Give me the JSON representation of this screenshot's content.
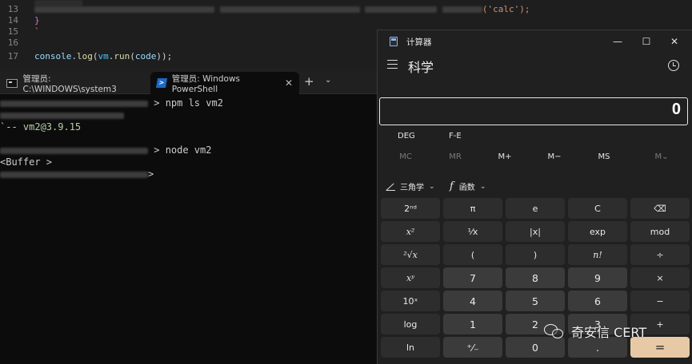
{
  "editor": {
    "lines": [
      {
        "num": "13",
        "code_tail": "('calc');"
      },
      {
        "num": "14",
        "code": "}"
      },
      {
        "num": "15",
        "code": "`"
      },
      {
        "num": "16",
        "code": ""
      },
      {
        "num": "17",
        "code_parts": [
          "console",
          ".",
          "log",
          "(",
          "vm",
          ".",
          "run",
          "(",
          "code",
          "));"
        ]
      }
    ]
  },
  "terminal": {
    "tabs": [
      {
        "label": "管理员: C:\\WINDOWS\\system3"
      },
      {
        "label": "管理员: Windows PowerShell"
      }
    ],
    "add_label": "+",
    "dropdown_label": "⌄",
    "lines": {
      "cmd1": "npm ls vm2",
      "tree": "`-- ",
      "pkg": "vm2@3.9.15",
      "cmd2": "node vm2",
      "buffer": "<Buffer >",
      "prompt_tail": ">"
    }
  },
  "calculator": {
    "title": "计算器",
    "window_controls": {
      "minimize": "—",
      "maximize": "☐",
      "close": "✕"
    },
    "mode": "科学",
    "display": "0",
    "angle_mode": "DEG",
    "notation": "F-E",
    "memory": [
      {
        "label": "MC",
        "enabled": false
      },
      {
        "label": "MR",
        "enabled": false
      },
      {
        "label": "M+",
        "enabled": true
      },
      {
        "label": "M−",
        "enabled": true
      },
      {
        "label": "MS",
        "enabled": true
      },
      {
        "label": "M⌄",
        "enabled": false
      }
    ],
    "dropdowns": {
      "trig": "三角学",
      "func_glyph": "f",
      "func": "函数",
      "chevron": "⌄"
    },
    "keys": [
      [
        "2ⁿᵈ",
        "π",
        "e",
        "C",
        "⌫"
      ],
      [
        "x²",
        "¹⁄x",
        "|x|",
        "exp",
        "mod"
      ],
      [
        "²√x",
        "(",
        ")",
        "n!",
        "÷"
      ],
      [
        "xʸ",
        "7",
        "8",
        "9",
        "×"
      ],
      [
        "10ˣ",
        "4",
        "5",
        "6",
        "−"
      ],
      [
        "log",
        "1",
        "2",
        "3",
        "+"
      ],
      [
        "ln",
        "⁺⁄₋",
        "0",
        ".",
        "="
      ]
    ]
  },
  "watermark": {
    "text": "奇安信 CERT"
  },
  "colors": {
    "accent": "#e8c9a6",
    "terminal_bg": "#0c0c0c",
    "calc_bg": "#202020"
  }
}
